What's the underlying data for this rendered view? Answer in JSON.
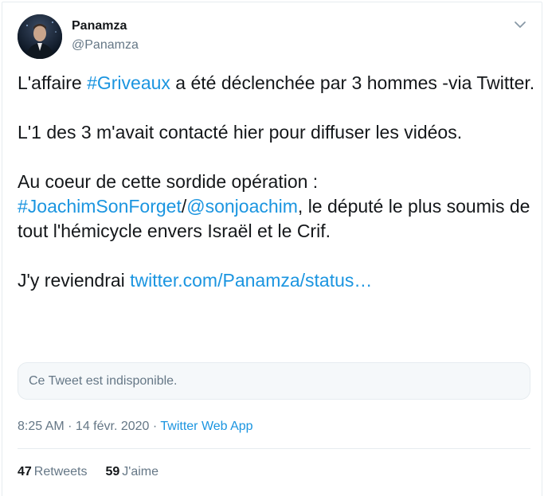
{
  "author": {
    "display_name": "Panamza",
    "handle": "@Panamza"
  },
  "tweet": {
    "line1_prefix": "L'affaire ",
    "line1_hashtag": "#Griveaux",
    "line1_suffix": " a été déclenchée par 3 hommes -via Twitter.",
    "para2": "L'1 des 3 m'avait contacté hier pour diffuser les vidéos.",
    "para3_intro": "Au coeur de cette sordide opération :",
    "para3_hashtag": "#JoachimSonForget",
    "para3_slash": "/",
    "para3_mention": "@sonjoachim",
    "para3_rest": ", le député le plus soumis de tout l'hémicycle envers Israël et le Crif.",
    "para4_prefix": "J'y reviendrai ",
    "para4_link": "twitter.com/Panamza/status…"
  },
  "quoted": {
    "unavailable_text": "Ce Tweet est indisponible."
  },
  "meta": {
    "time": "8:25 AM",
    "separator1": " · ",
    "date": "14 févr. 2020",
    "separator2": " · ",
    "source": "Twitter Web App"
  },
  "stats": {
    "retweets_count": "47",
    "retweets_label": "Retweets",
    "likes_count": "59",
    "likes_label": "J'aime"
  },
  "icons": {
    "caret": "chevron-down-icon",
    "avatar": "avatar"
  },
  "colors": {
    "link": "#1b95e0",
    "text": "#14171a",
    "secondary": "#657786",
    "border": "#e6ecf0"
  }
}
